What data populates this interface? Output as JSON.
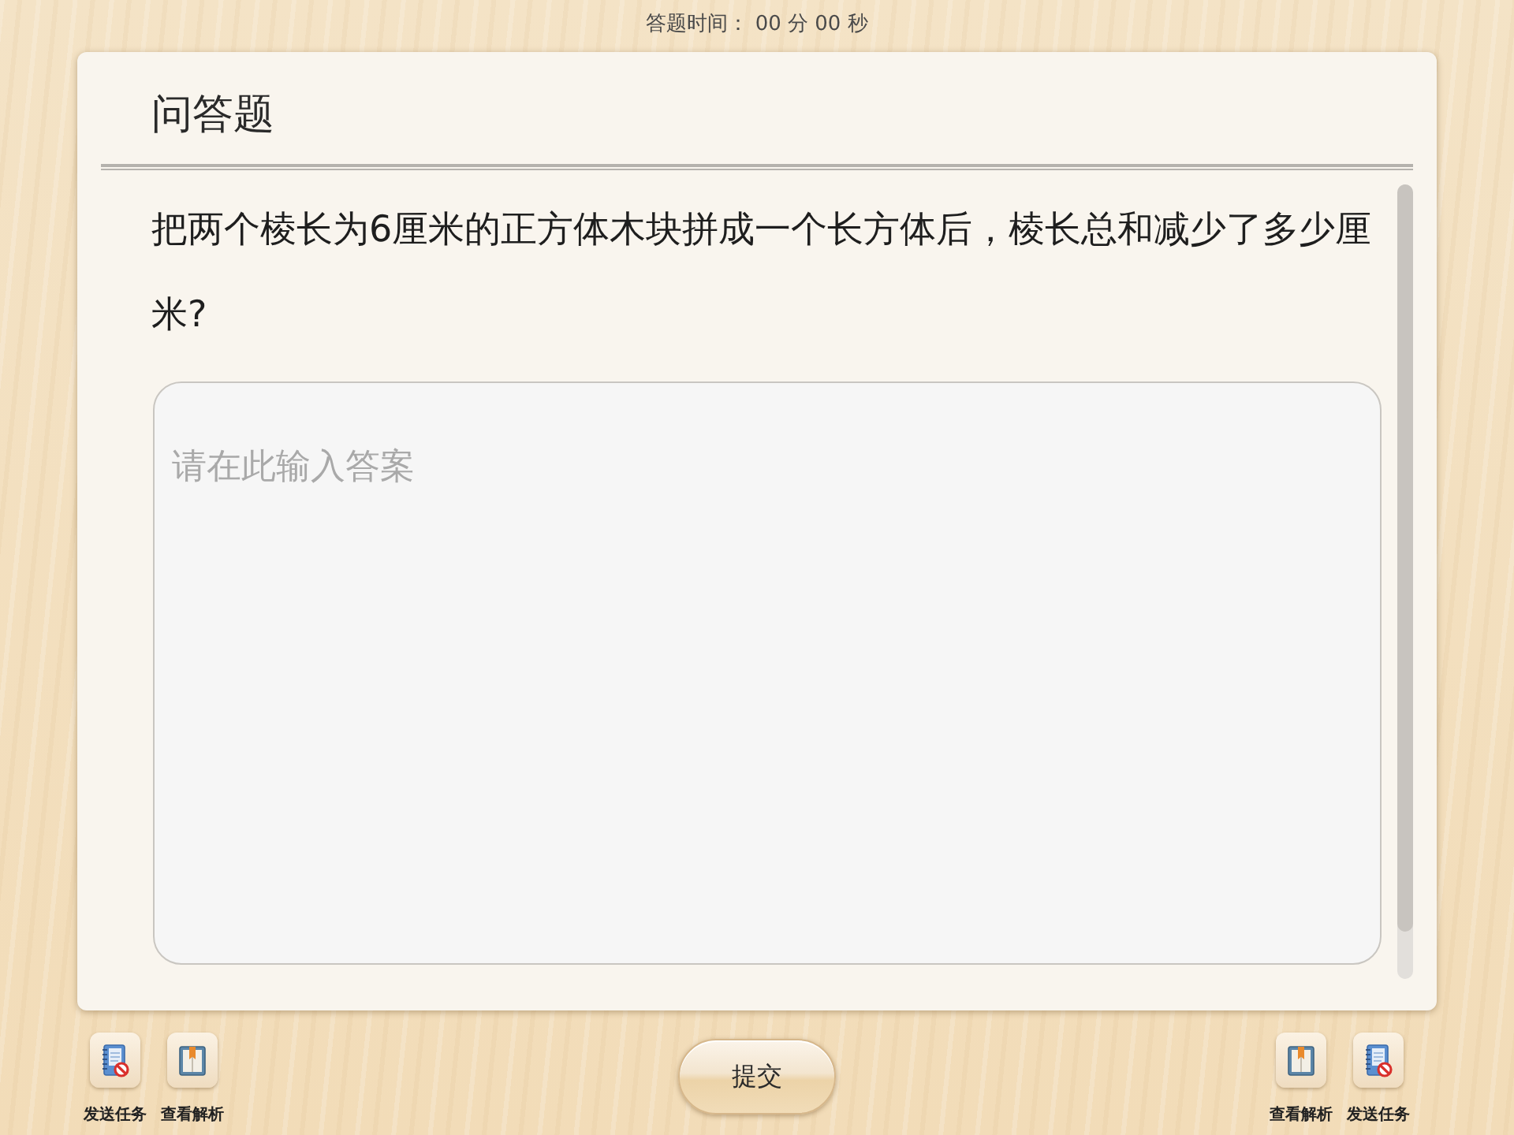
{
  "timer": "答题时间： 00 分 00 秒",
  "card": {
    "title": "问答题",
    "question": "把两个棱长为6厘米的正方体木块拼成一个长方体后，棱长总和减少了多少厘米?",
    "answer": {
      "placeholder": "请在此输入答案"
    }
  },
  "left_tools": [
    {
      "kind": "send-task",
      "label": "发送任务"
    },
    {
      "kind": "view-analysis",
      "label": "查看解析"
    }
  ],
  "submit_button": "提交",
  "right_tools": [
    {
      "kind": "view-analysis",
      "label": "查看解析"
    },
    {
      "kind": "send-task",
      "label": "发送任务"
    }
  ]
}
